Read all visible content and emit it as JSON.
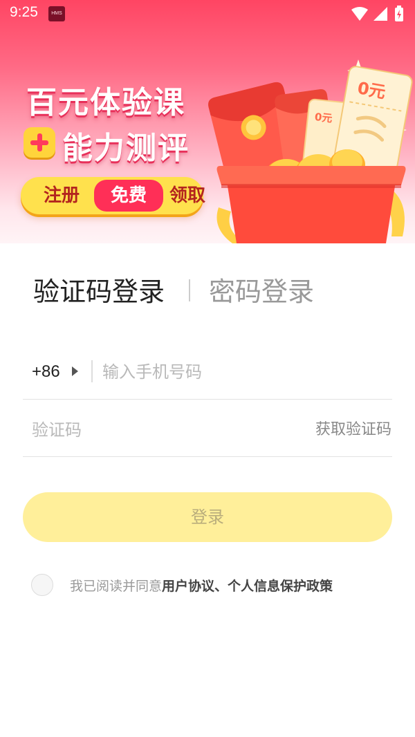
{
  "status_bar": {
    "time": "9:25",
    "notification_badge": "HMS",
    "icons": [
      "wifi-icon",
      "cell-signal-icon",
      "battery-charging-icon"
    ]
  },
  "banner": {
    "title_line1": "百元体验课",
    "title_line2": "能力测评",
    "pill_left": "注册",
    "pill_mid": "免费",
    "pill_right": "领取",
    "ticket_front_text": "0元",
    "ticket_back_text": "0元",
    "coin_symbol": "¥"
  },
  "login": {
    "tab_active": "验证码登录",
    "tab_inactive": "密码登录",
    "country_code": "+86",
    "phone_placeholder": "输入手机号码",
    "code_placeholder": "验证码",
    "get_code_label": "获取验证码",
    "submit_label": "登录"
  },
  "agreement": {
    "prefix": "我已阅读并同意",
    "user_agreement": "用户协议",
    "separator": "、",
    "privacy_policy": "个人信息保护政策"
  },
  "colors": {
    "banner_top": "#ff4563",
    "accent_yellow": "#ffe14d",
    "button_disabled_bg": "#ffef9a",
    "button_disabled_text": "#b9ad7c",
    "highlight_red": "#ff2f57"
  }
}
